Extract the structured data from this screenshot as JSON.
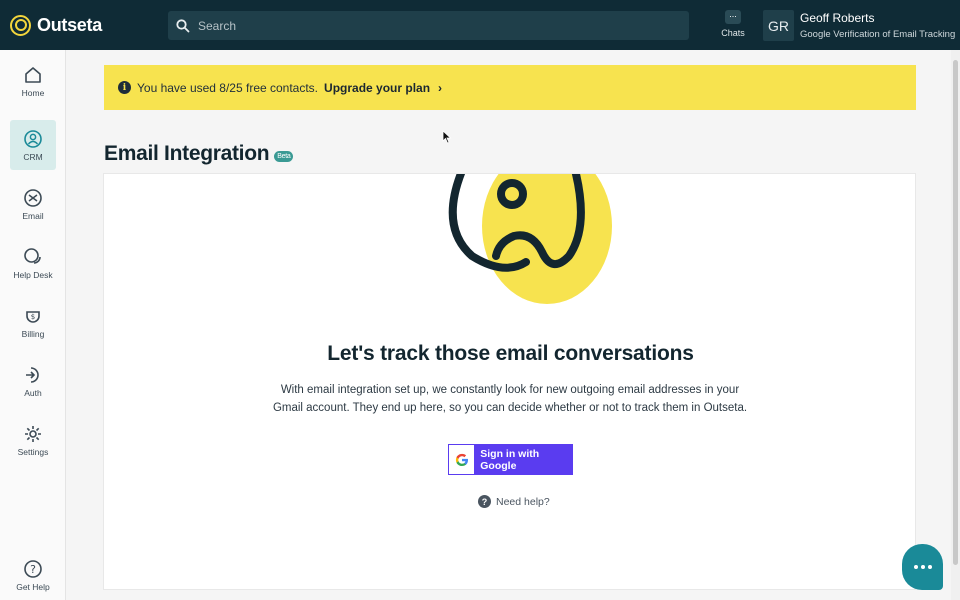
{
  "app": {
    "name": "Outseta"
  },
  "search": {
    "placeholder": "Search"
  },
  "header": {
    "chats_label": "Chats",
    "user_initials": "GR",
    "user_name": "Geoff Roberts",
    "user_subtitle": "Google Verification of Email Tracking"
  },
  "sidebar": {
    "items": [
      {
        "label": "Home",
        "icon": "home-icon"
      },
      {
        "label": "CRM",
        "icon": "crm-icon",
        "active": true
      },
      {
        "label": "Email",
        "icon": "email-icon"
      },
      {
        "label": "Help Desk",
        "icon": "help-desk-icon"
      },
      {
        "label": "Billing",
        "icon": "billing-icon"
      },
      {
        "label": "Auth",
        "icon": "auth-icon"
      },
      {
        "label": "Settings",
        "icon": "gear-icon"
      }
    ],
    "footer": {
      "label": "Get Help",
      "icon": "question-icon"
    }
  },
  "banner": {
    "text": "You have used 8/25 free contacts.",
    "link": "Upgrade your plan"
  },
  "page": {
    "title": "Email Integration",
    "badge": "Beta"
  },
  "main": {
    "headline": "Let's track those email conversations",
    "description": "With email integration set up, we constantly look for new outgoing email addresses in your Gmail account. They end up here, so you can decide whether or not to track them in Outseta.",
    "google_button": "Sign in with Google",
    "help_link": "Need help?"
  },
  "colors": {
    "topbar": "#0f2b36",
    "banner": "#f7e34f",
    "accent_purple": "#5a3cf0",
    "teal": "#1a8a98",
    "active_nav": "#d8eceb"
  }
}
